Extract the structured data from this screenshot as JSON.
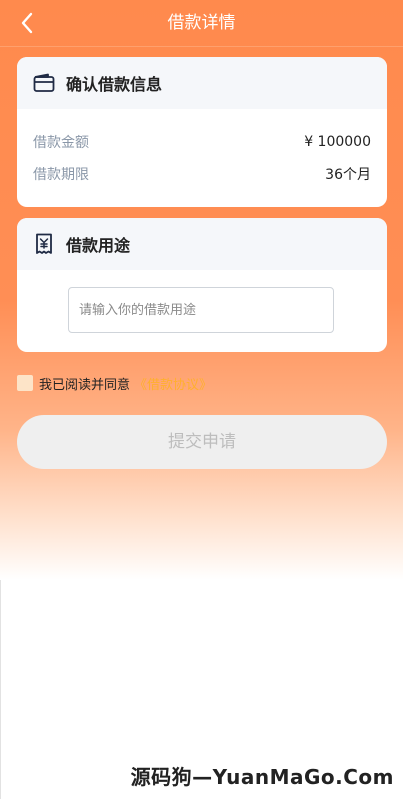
{
  "header": {
    "title": "借款详情"
  },
  "loan_info": {
    "title": "确认借款信息",
    "icon": "wallet-icon",
    "rows": [
      {
        "label": "借款金额",
        "value": "¥ 100000"
      },
      {
        "label": "借款期限",
        "value": "36个月"
      }
    ]
  },
  "purpose": {
    "title": "借款用途",
    "icon": "receipt-icon",
    "input_value": "",
    "placeholder": "请输入你的借款用途"
  },
  "agreement": {
    "text": "我已阅读并同意",
    "link": "《借款协议》"
  },
  "submit": {
    "label": "提交申请"
  },
  "watermark": "源码狗—YuanMaGo.Com",
  "colors": {
    "primary": "#ff8a4d",
    "link": "#ffb02e",
    "button_disabled_bg": "#efefef",
    "button_disabled_text": "#bdbdbd"
  }
}
